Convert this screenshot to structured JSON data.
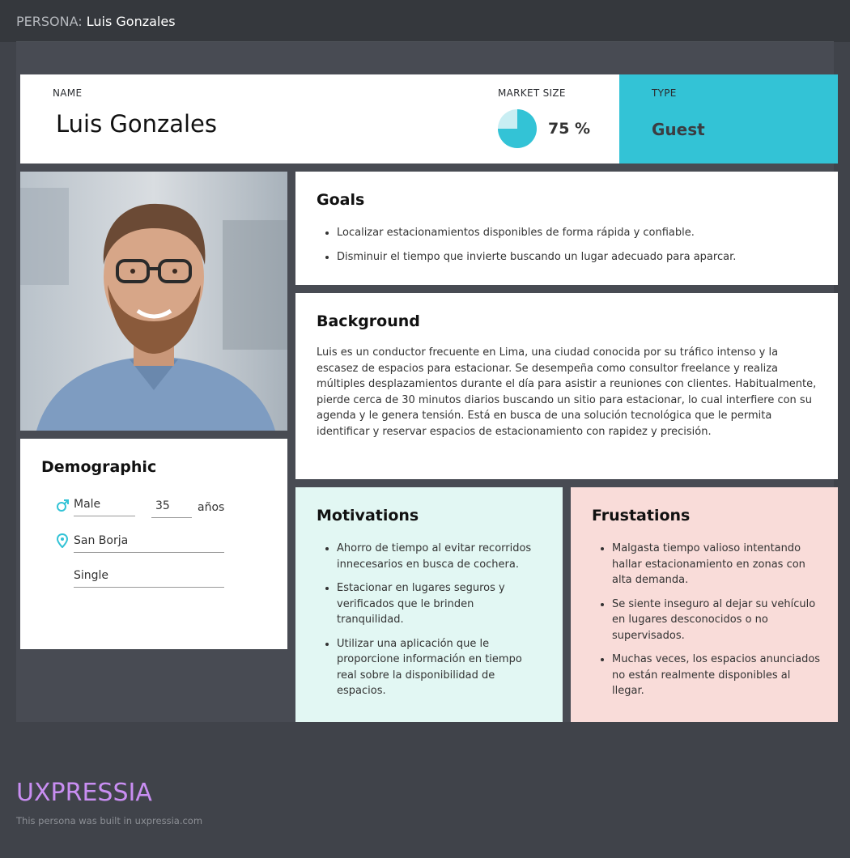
{
  "header": {
    "prefix": "PERSONA:",
    "persona_name": "Luis Gonzales"
  },
  "profile": {
    "name_label": "NAME",
    "name_value": "Luis Gonzales",
    "market_size_label": "MARKET SIZE",
    "market_size_value": "75 %",
    "market_size_fraction": 0.75,
    "type_label": "TYPE",
    "type_value": "Guest",
    "accent_color": "#33c3d6"
  },
  "demographic": {
    "title": "Demographic",
    "gender": "Male",
    "age": "35",
    "age_unit": "años",
    "location": "San Borja",
    "status": "Single",
    "gender_icon": "male-icon",
    "location_icon": "map-pin-icon"
  },
  "goals": {
    "title": "Goals",
    "items": [
      "Localizar estacionamientos disponibles de forma rápida y confiable.",
      "Disminuir el tiempo que invierte buscando un lugar adecuado para aparcar."
    ]
  },
  "background": {
    "title": "Background",
    "text": "Luis es un conductor frecuente en Lima, una ciudad conocida por su tráfico intenso y la escasez de espacios para estacionar. Se desempeña como consultor freelance y realiza múltiples desplazamientos durante el día para asistir a reuniones con clientes. Habitualmente, pierde cerca de 30 minutos diarios buscando un sitio para estacionar, lo cual interfiere con su agenda y le genera tensión. Está en busca de una solución tecnológica que le permita identificar y reservar espacios de estacionamiento con rapidez y precisión."
  },
  "motivations": {
    "title": "Motivations",
    "items": [
      "Ahorro de tiempo al evitar recorridos innecesarios en busca de cochera.",
      "Estacionar en lugares seguros y verificados que le brinden tranquilidad.",
      "Utilizar una aplicación que le proporcione información en tiempo real sobre la disponibilidad de espacios."
    ]
  },
  "frustrations": {
    "title": "Frustations",
    "items": [
      "Malgasta tiempo valioso intentando hallar estacionamiento en zonas con alta demanda.",
      "Se siente inseguro al dejar su vehículo en lugares desconocidos o no supervisados.",
      "Muchas veces, los espacios anunciados no están realmente disponibles al llegar."
    ]
  },
  "footer": {
    "logo": "UXPRESSIA",
    "built_text": "This persona was built in uxpressia.com"
  }
}
